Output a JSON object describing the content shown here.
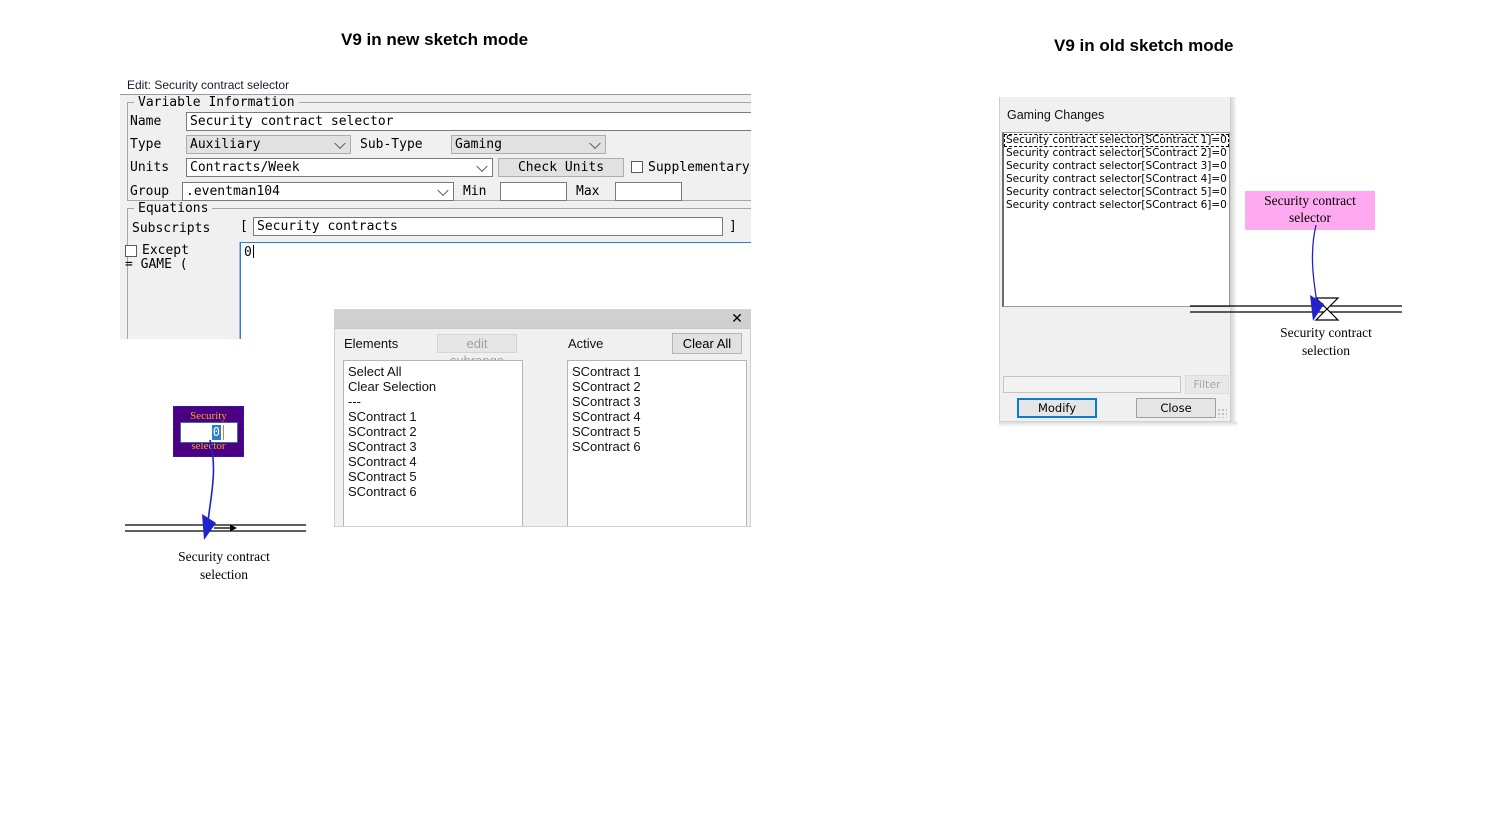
{
  "sections": {
    "left_title": "V9 in new sketch mode",
    "right_title": "V9 in old sketch mode"
  },
  "edit_dialog": {
    "header": "Edit: Security contract selector",
    "group_variable_information": "Variable Information",
    "group_equations": "Equations",
    "fields": {
      "name_label": "Name",
      "name_value": "Security contract selector",
      "type_label": "Type",
      "type_value": "Auxiliary",
      "subtype_label": "Sub-Type",
      "subtype_value": "Gaming",
      "units_label": "Units",
      "units_value": "Contracts/Week",
      "check_units_button": "Check Units",
      "supplementary_label": "Supplementary",
      "group_label": "Group",
      "group_value": ".eventman104",
      "min_label": "Min",
      "min_value": "",
      "max_label": "Max",
      "max_value": "",
      "subscripts_label": "Subscripts",
      "bracket_open": "[",
      "subscripts_value": "Security contracts",
      "bracket_close": "]",
      "except_label": "Except",
      "equation_prefix": "= GAME (",
      "equation_value": "0"
    }
  },
  "subscript_dialog": {
    "close_icon": "✕",
    "elements_header": "Elements",
    "edit_subrange_button": "edit subrange",
    "active_header": "Active",
    "clear_all_button": "Clear All",
    "elements_list": [
      "Select All",
      "Clear Selection",
      "---",
      "SContract 1",
      "SContract 2",
      "SContract 3",
      "SContract 4",
      "SContract 5",
      "SContract 6"
    ],
    "active_list": [
      "SContract 1",
      "SContract 2",
      "SContract 3",
      "SContract 4",
      "SContract 5",
      "SContract 6"
    ]
  },
  "gaming_dialog": {
    "title": "Gaming Changes",
    "items": [
      "Security contract selector[SContract 1]=0",
      "Security contract selector[SContract 2]=0",
      "Security contract selector[SContract 3]=0",
      "Security contract selector[SContract 4]=0",
      "Security contract selector[SContract 5]=0",
      "Security contract selector[SContract 6]=0"
    ],
    "filter_value": "",
    "filter_button": "Filter",
    "modify_button": "Modify",
    "close_button": "Close"
  },
  "left_diagram": {
    "node_line1": "Security",
    "node_line2": "selector",
    "node_input_value": "0",
    "flow_label_line1": "Security contract",
    "flow_label_line2": "selection",
    "node_fill_color": "#4B0082",
    "node_text_color": "#f5a623"
  },
  "right_diagram": {
    "node_line1": "Security contract",
    "node_line2": "selector",
    "flow_label_line1": "Security contract",
    "flow_label_line2": "selection",
    "node_fill_color": "#ffaaf0"
  }
}
